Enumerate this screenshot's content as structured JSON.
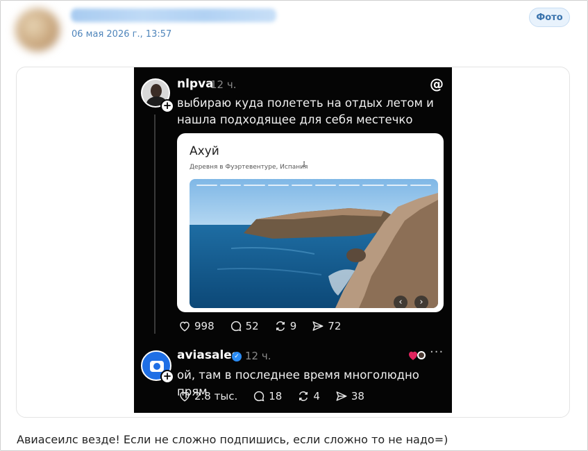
{
  "post": {
    "date": "06 мая 2026 г., 13:57",
    "badge_label": "Фото",
    "caption": "Авиасеилс везде! Если не сложно подпишись, если сложно то не надо=)"
  },
  "screenshot": {
    "post1": {
      "username": "nlpva",
      "time": "12 ч.",
      "text_line1": "выбираю куда полететь на отдых летом и",
      "text_line2": "нашла подходящее для себя местечко",
      "place_name": "Ахуй",
      "place_subtitle": "Деревня в Фуэртевентуре, Испания",
      "likes": "998",
      "comments": "52",
      "reposts": "9",
      "shares": "72"
    },
    "post2": {
      "username": "aviasales",
      "time": "12 ч.",
      "text": "ой, там в последнее время многолюдно прям",
      "likes": "2.8 тыс.",
      "comments": "18",
      "reposts": "4",
      "shares": "38"
    }
  },
  "icons": {
    "plus": "+",
    "threads": "@",
    "more_dots": "⋮",
    "post_more": "···",
    "prev": "‹",
    "next": "›",
    "check": "✓"
  },
  "colors": {
    "accent": "#4f85bb",
    "verified": "#2a8cf5",
    "aviasales_blue": "#1f6fe5"
  }
}
